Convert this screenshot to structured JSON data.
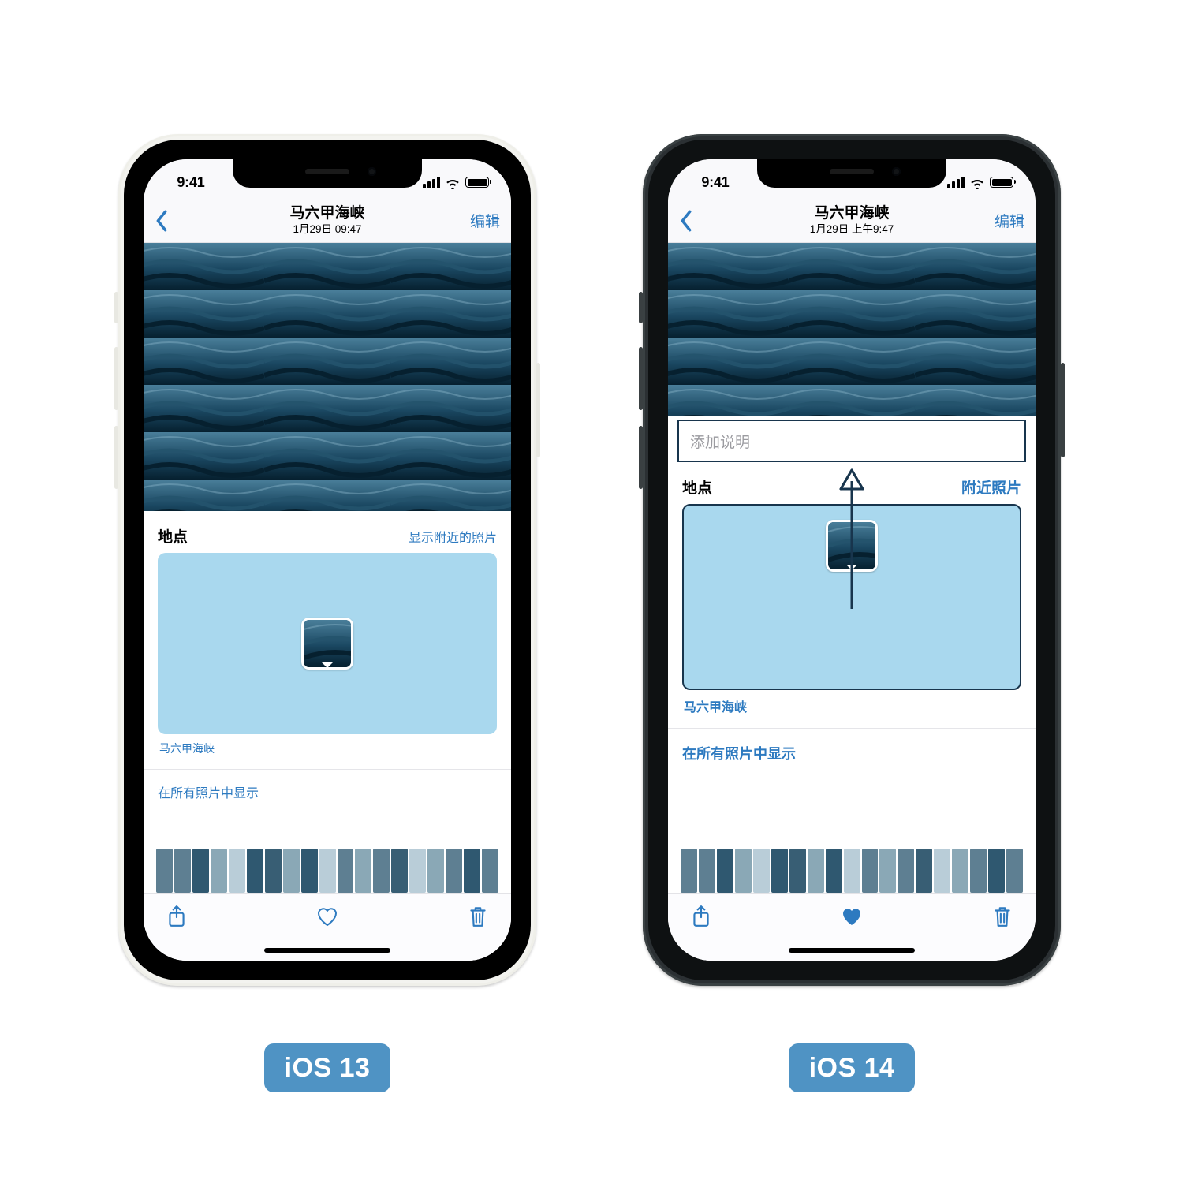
{
  "common": {
    "status_time": "9:41",
    "nav_title": "马六甲海峡",
    "nav_edit": "编辑",
    "place_label": "地点",
    "map_caption": "马六甲海峡",
    "show_in_all": "在所有照片中显示",
    "accent": "#2d7ac0",
    "caption_border": "#18354d",
    "map_bg": "#a9d8ee"
  },
  "ios13": {
    "nav_sub": "1月29日  09:47",
    "nearby_label": "显示附近的照片",
    "heart_filled": false,
    "version_label": "iOS 13"
  },
  "ios14": {
    "nav_sub": "1月29日 上午9:47",
    "nearby_label": "附近照片",
    "caption_placeholder": "添加说明",
    "heart_filled": true,
    "version_label": "iOS 14"
  }
}
